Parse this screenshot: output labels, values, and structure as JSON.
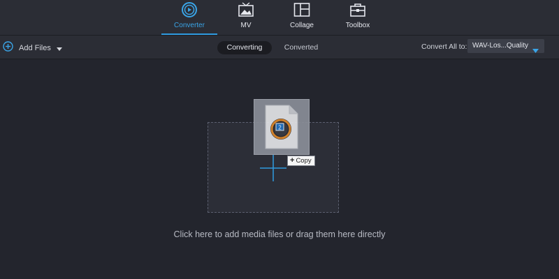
{
  "nav": {
    "tabs": [
      {
        "label": "Converter",
        "icon": "converter-icon",
        "active": true
      },
      {
        "label": "MV",
        "icon": "mv-icon",
        "active": false
      },
      {
        "label": "Collage",
        "icon": "collage-icon",
        "active": false
      },
      {
        "label": "Toolbox",
        "icon": "toolbox-icon",
        "active": false
      }
    ]
  },
  "toolbar": {
    "add_files_label": "Add Files",
    "segments": [
      "Converting",
      "Converted"
    ],
    "convert_all_label": "Convert All to:",
    "format_value": "WAV-Los...Quality"
  },
  "dropzone": {
    "hint": "Click here to add media files or drag them here directly",
    "badge_number": "2",
    "copy_label": "Copy",
    "copy_symbol": "+"
  },
  "colors": {
    "background": "#23252d",
    "accent": "#2f9be0",
    "panel": "#2b2d35"
  }
}
